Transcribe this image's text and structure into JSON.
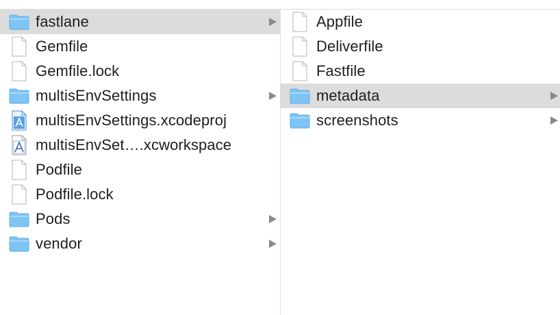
{
  "column1": {
    "items": [
      {
        "label": "fastlane",
        "type": "folder",
        "selected": true,
        "has_children": true
      },
      {
        "label": "Gemfile",
        "type": "file"
      },
      {
        "label": "Gemfile.lock",
        "type": "file"
      },
      {
        "label": "multisEnvSettings",
        "type": "folder",
        "has_children": true
      },
      {
        "label": "multisEnvSettings.xcodeproj",
        "type": "xcodeproj"
      },
      {
        "label": "multisEnvSet….xcworkspace",
        "type": "xcworkspace"
      },
      {
        "label": "Podfile",
        "type": "file"
      },
      {
        "label": "Podfile.lock",
        "type": "file"
      },
      {
        "label": "Pods",
        "type": "folder",
        "has_children": true
      },
      {
        "label": "vendor",
        "type": "folder",
        "has_children": true
      }
    ]
  },
  "column2": {
    "items": [
      {
        "label": "Appfile",
        "type": "file"
      },
      {
        "label": "Deliverfile",
        "type": "file"
      },
      {
        "label": "Fastfile",
        "type": "file"
      },
      {
        "label": "metadata",
        "type": "folder",
        "selected": true,
        "has_children": true
      },
      {
        "label": "screenshots",
        "type": "folder",
        "has_children": true
      }
    ]
  },
  "colors": {
    "folder_fill": "#7ec4f4",
    "folder_tab": "#9ed3f7",
    "selection": "#dcdcdc",
    "chevron": "#8a8a8a"
  }
}
